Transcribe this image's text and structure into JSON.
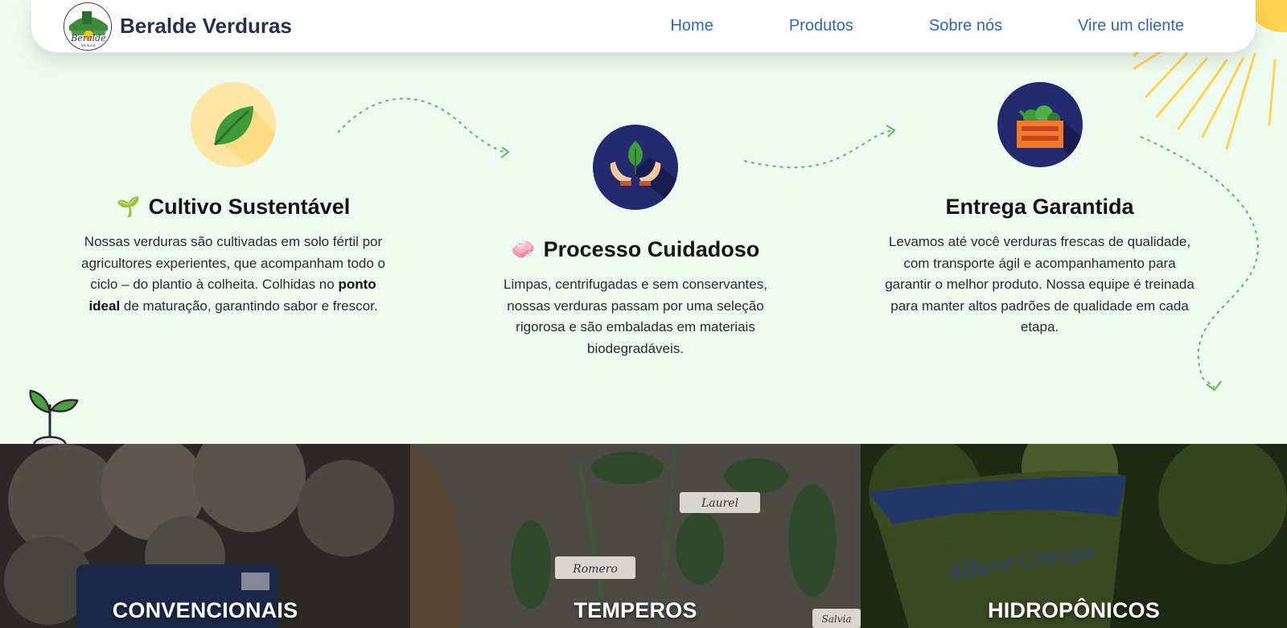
{
  "brand": {
    "name": "Beralde Verduras",
    "logo_text": "Beralde",
    "logo_sub": "Verduras"
  },
  "nav": [
    {
      "label": "Home"
    },
    {
      "label": "Produtos"
    },
    {
      "label": "Sobre nós"
    },
    {
      "label": "Vire um cliente"
    }
  ],
  "features": [
    {
      "icon": "leaf-icon",
      "emoji": "🌱",
      "title": "Cultivo Sustentável",
      "text_before": "Nossas verduras são cultivadas em solo fértil por agricultores experientes, que acompanham todo o ciclo – do plantio à colheita. Colhidas no ",
      "text_bold": "ponto ideal",
      "text_after": " de maturação, garantindo sabor e frescor."
    },
    {
      "icon": "hands-leaf-icon",
      "emoji": "🧼",
      "title": "Processo Cuidadoso",
      "text": "Limpas, centrifugadas e sem conservantes, nossas verduras passam por uma seleção rigorosa e são embaladas em materiais biodegradáveis."
    },
    {
      "icon": "vegetable-crate-icon",
      "title": "Entrega Garantida",
      "text": "Levamos até você verduras frescas de qualidade, com transporte ágil e acompanhamento para garantir o melhor produto. Nossa equipe é treinada para manter altos padrões de qualidade em cada etapa."
    }
  ],
  "categories": [
    {
      "label": "CONVENCIONAIS"
    },
    {
      "label": "TEMPEROS",
      "tag1": "Laurel",
      "tag2": "Romero",
      "tag3": "Salvia"
    },
    {
      "label": "HIDROPÔNICOS",
      "bag_text": "Alface Crespa"
    }
  ],
  "colors": {
    "background": "#eefbf1",
    "nav_link": "#3466b3",
    "brand_text": "#253249",
    "sun": "#ffd34d",
    "dashed_path": "#5cb85c"
  }
}
